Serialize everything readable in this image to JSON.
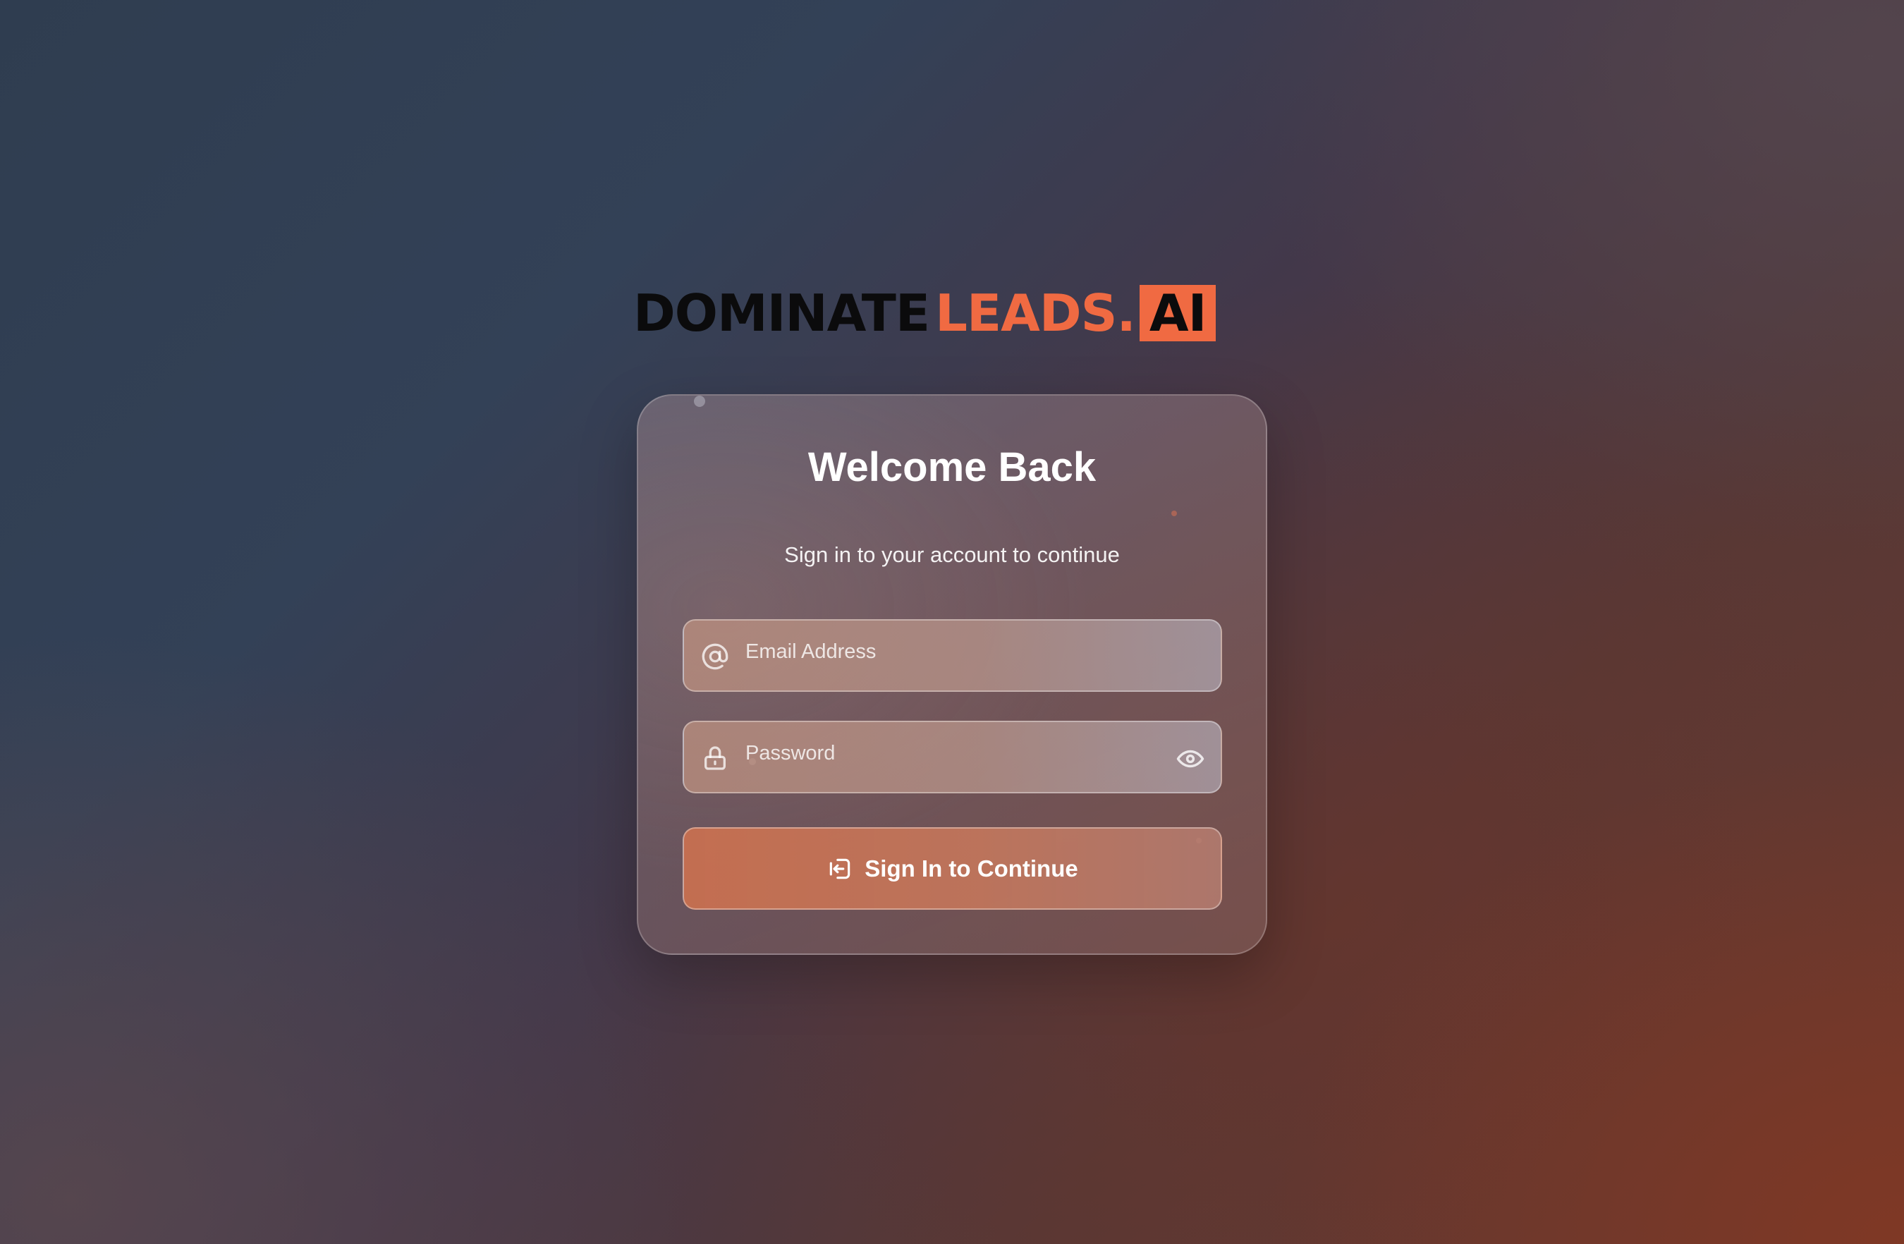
{
  "brand": {
    "logo_part1": "DOMINATE",
    "logo_part2": "LEADS.",
    "logo_part3": "AI",
    "accent_color": "#f06a42",
    "dark_color": "#0b0b0c"
  },
  "login": {
    "title": "Welcome Back",
    "subtitle": "Sign in to your account to continue",
    "email": {
      "placeholder": "Email Address",
      "value": "",
      "icon": "at-sign-icon"
    },
    "password": {
      "placeholder": "Password",
      "value": "",
      "icon": "lock-icon",
      "toggle_icon": "eye-icon"
    },
    "submit": {
      "label": "Sign In to Continue",
      "icon": "sign-in-icon"
    }
  }
}
